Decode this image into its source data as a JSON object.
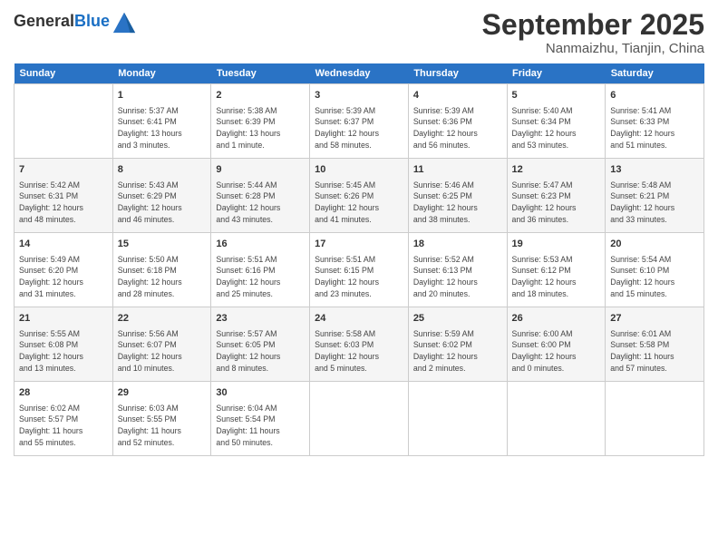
{
  "header": {
    "logo_line1": "General",
    "logo_line2": "Blue",
    "month": "September 2025",
    "location": "Nanmaizhu, Tianjin, China"
  },
  "days_of_week": [
    "Sunday",
    "Monday",
    "Tuesday",
    "Wednesday",
    "Thursday",
    "Friday",
    "Saturday"
  ],
  "weeks": [
    [
      {
        "day": "",
        "info": ""
      },
      {
        "day": "1",
        "info": "Sunrise: 5:37 AM\nSunset: 6:41 PM\nDaylight: 13 hours\nand 3 minutes."
      },
      {
        "day": "2",
        "info": "Sunrise: 5:38 AM\nSunset: 6:39 PM\nDaylight: 13 hours\nand 1 minute."
      },
      {
        "day": "3",
        "info": "Sunrise: 5:39 AM\nSunset: 6:37 PM\nDaylight: 12 hours\nand 58 minutes."
      },
      {
        "day": "4",
        "info": "Sunrise: 5:39 AM\nSunset: 6:36 PM\nDaylight: 12 hours\nand 56 minutes."
      },
      {
        "day": "5",
        "info": "Sunrise: 5:40 AM\nSunset: 6:34 PM\nDaylight: 12 hours\nand 53 minutes."
      },
      {
        "day": "6",
        "info": "Sunrise: 5:41 AM\nSunset: 6:33 PM\nDaylight: 12 hours\nand 51 minutes."
      }
    ],
    [
      {
        "day": "7",
        "info": "Sunrise: 5:42 AM\nSunset: 6:31 PM\nDaylight: 12 hours\nand 48 minutes."
      },
      {
        "day": "8",
        "info": "Sunrise: 5:43 AM\nSunset: 6:29 PM\nDaylight: 12 hours\nand 46 minutes."
      },
      {
        "day": "9",
        "info": "Sunrise: 5:44 AM\nSunset: 6:28 PM\nDaylight: 12 hours\nand 43 minutes."
      },
      {
        "day": "10",
        "info": "Sunrise: 5:45 AM\nSunset: 6:26 PM\nDaylight: 12 hours\nand 41 minutes."
      },
      {
        "day": "11",
        "info": "Sunrise: 5:46 AM\nSunset: 6:25 PM\nDaylight: 12 hours\nand 38 minutes."
      },
      {
        "day": "12",
        "info": "Sunrise: 5:47 AM\nSunset: 6:23 PM\nDaylight: 12 hours\nand 36 minutes."
      },
      {
        "day": "13",
        "info": "Sunrise: 5:48 AM\nSunset: 6:21 PM\nDaylight: 12 hours\nand 33 minutes."
      }
    ],
    [
      {
        "day": "14",
        "info": "Sunrise: 5:49 AM\nSunset: 6:20 PM\nDaylight: 12 hours\nand 31 minutes."
      },
      {
        "day": "15",
        "info": "Sunrise: 5:50 AM\nSunset: 6:18 PM\nDaylight: 12 hours\nand 28 minutes."
      },
      {
        "day": "16",
        "info": "Sunrise: 5:51 AM\nSunset: 6:16 PM\nDaylight: 12 hours\nand 25 minutes."
      },
      {
        "day": "17",
        "info": "Sunrise: 5:51 AM\nSunset: 6:15 PM\nDaylight: 12 hours\nand 23 minutes."
      },
      {
        "day": "18",
        "info": "Sunrise: 5:52 AM\nSunset: 6:13 PM\nDaylight: 12 hours\nand 20 minutes."
      },
      {
        "day": "19",
        "info": "Sunrise: 5:53 AM\nSunset: 6:12 PM\nDaylight: 12 hours\nand 18 minutes."
      },
      {
        "day": "20",
        "info": "Sunrise: 5:54 AM\nSunset: 6:10 PM\nDaylight: 12 hours\nand 15 minutes."
      }
    ],
    [
      {
        "day": "21",
        "info": "Sunrise: 5:55 AM\nSunset: 6:08 PM\nDaylight: 12 hours\nand 13 minutes."
      },
      {
        "day": "22",
        "info": "Sunrise: 5:56 AM\nSunset: 6:07 PM\nDaylight: 12 hours\nand 10 minutes."
      },
      {
        "day": "23",
        "info": "Sunrise: 5:57 AM\nSunset: 6:05 PM\nDaylight: 12 hours\nand 8 minutes."
      },
      {
        "day": "24",
        "info": "Sunrise: 5:58 AM\nSunset: 6:03 PM\nDaylight: 12 hours\nand 5 minutes."
      },
      {
        "day": "25",
        "info": "Sunrise: 5:59 AM\nSunset: 6:02 PM\nDaylight: 12 hours\nand 2 minutes."
      },
      {
        "day": "26",
        "info": "Sunrise: 6:00 AM\nSunset: 6:00 PM\nDaylight: 12 hours\nand 0 minutes."
      },
      {
        "day": "27",
        "info": "Sunrise: 6:01 AM\nSunset: 5:58 PM\nDaylight: 11 hours\nand 57 minutes."
      }
    ],
    [
      {
        "day": "28",
        "info": "Sunrise: 6:02 AM\nSunset: 5:57 PM\nDaylight: 11 hours\nand 55 minutes."
      },
      {
        "day": "29",
        "info": "Sunrise: 6:03 AM\nSunset: 5:55 PM\nDaylight: 11 hours\nand 52 minutes."
      },
      {
        "day": "30",
        "info": "Sunrise: 6:04 AM\nSunset: 5:54 PM\nDaylight: 11 hours\nand 50 minutes."
      },
      {
        "day": "",
        "info": ""
      },
      {
        "day": "",
        "info": ""
      },
      {
        "day": "",
        "info": ""
      },
      {
        "day": "",
        "info": ""
      }
    ]
  ]
}
